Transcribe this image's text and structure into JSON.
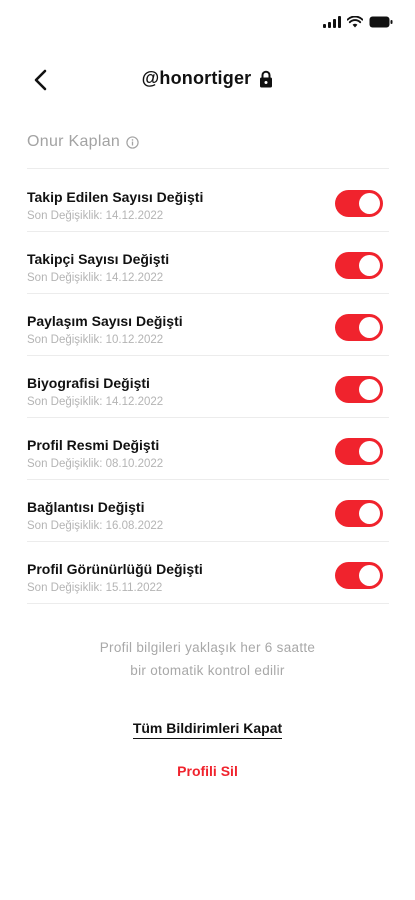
{
  "status_bar": {
    "icons": [
      "signal-icon",
      "wifi-icon",
      "battery-icon"
    ]
  },
  "header": {
    "title": "@honortiger",
    "icons": [
      "back-arrow-icon",
      "lock-icon"
    ]
  },
  "profile": {
    "name": "Onur Kaplan",
    "icon": "info-icon"
  },
  "settings": [
    {
      "title": "Takip Edilen Sayısı Değişti",
      "subtitle": "Son Değişiklik: 14.12.2022",
      "enabled": true
    },
    {
      "title": "Takipçi Sayısı Değişti",
      "subtitle": "Son Değişiklik: 14.12.2022",
      "enabled": true
    },
    {
      "title": "Paylaşım Sayısı Değişti",
      "subtitle": "Son Değişiklik: 10.12.2022",
      "enabled": true
    },
    {
      "title": "Biyografisi Değişti",
      "subtitle": "Son Değişiklik: 14.12.2022",
      "enabled": true
    },
    {
      "title": "Profil Resmi Değişti",
      "subtitle": "Son Değişiklik: 08.10.2022",
      "enabled": true
    },
    {
      "title": "Bağlantısı Değişti",
      "subtitle": "Son Değişiklik: 16.08.2022",
      "enabled": true
    },
    {
      "title": "Profil Görünürlüğü Değişti",
      "subtitle": "Son Değişiklik: 15.11.2022",
      "enabled": true
    }
  ],
  "info_note": {
    "line1": "Profil bilgileri yaklaşık her 6 saatte",
    "line2": "bir otomatik kontrol edilir"
  },
  "actions": {
    "close_all_label": "Tüm Bildirimleri Kapat",
    "delete_profile_label": "Profili Sil"
  },
  "colors": {
    "accent": "#f0232d",
    "muted": "#a8a8a8",
    "text": "#111111"
  }
}
